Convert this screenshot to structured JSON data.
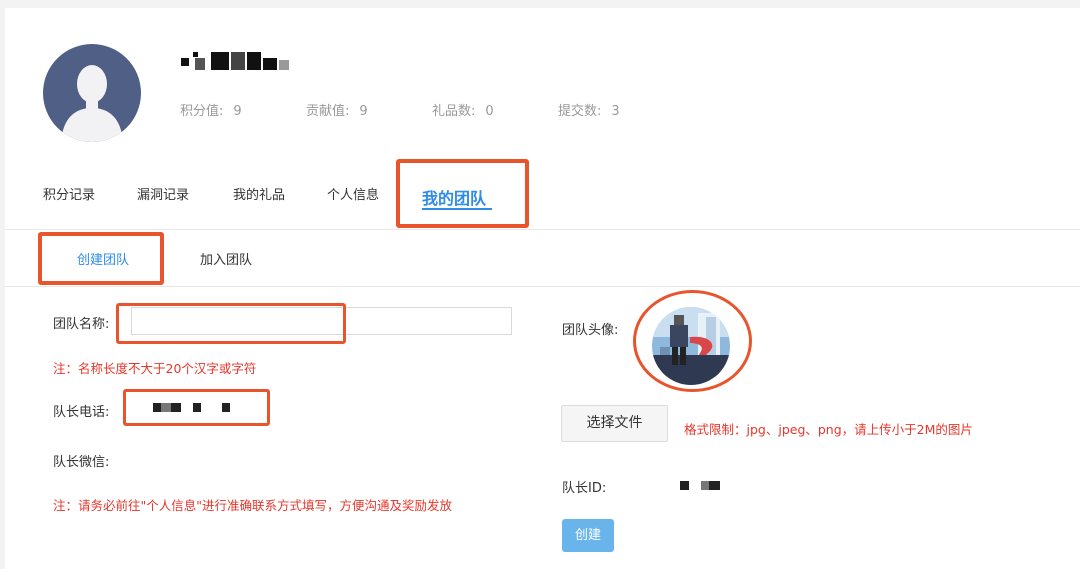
{
  "profile": {
    "username": "",
    "stats": [
      {
        "label": "积分值:",
        "value": "9"
      },
      {
        "label": "贡献值:",
        "value": "9"
      },
      {
        "label": "礼品数:",
        "value": "0"
      },
      {
        "label": "提交数:",
        "value": "3"
      }
    ]
  },
  "tabs": [
    {
      "label": "积分记录"
    },
    {
      "label": "漏洞记录"
    },
    {
      "label": "我的礼品"
    },
    {
      "label": "个人信息"
    },
    {
      "label": "我的团队",
      "active": true
    }
  ],
  "subtabs": [
    {
      "label": "创建团队",
      "active": true
    },
    {
      "label": "加入团队"
    }
  ],
  "form": {
    "team_name_label": "团队名称:",
    "team_name_value": "",
    "name_note": "注：名称长度不大于20个汉字或字符",
    "leader_phone_label": "队长电话:",
    "leader_wechat_label": "队长微信:",
    "contact_note": "注：请务必前往\"个人信息\"进行准确联系方式填写，方便沟通及奖励发放",
    "team_avatar_label": "团队头像:",
    "file_button": "选择文件",
    "format_note": "格式限制：jpg、jpeg、png，请上传小于2M的图片",
    "leader_id_label": "队长ID:",
    "create_button": "创建"
  },
  "colors": {
    "accent": "#2e8ce6",
    "highlight": "#e8552c",
    "note": "#e8372c",
    "button": "#6ab4ec"
  }
}
